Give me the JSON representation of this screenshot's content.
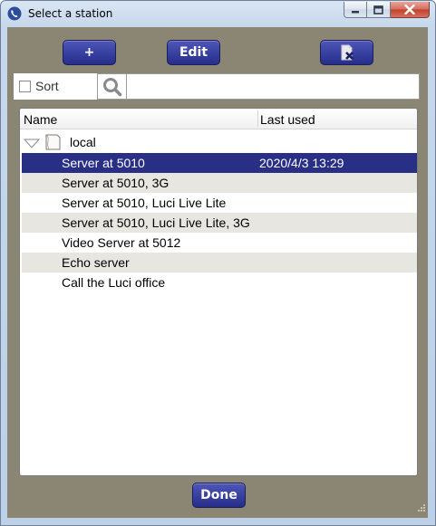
{
  "window": {
    "title": "Select a station",
    "icons": {
      "app": "phone-icon",
      "minimize": "minimize-icon",
      "maximize": "maximize-icon",
      "close": "close-icon"
    }
  },
  "toolbar": {
    "add_label": "+",
    "edit_label": "Edit",
    "delete_icon": "delete-document-icon"
  },
  "filter": {
    "sort_label": "Sort",
    "sort_checked": false,
    "search_value": "",
    "search_icon": "search-icon"
  },
  "list": {
    "columns": [
      "Name",
      "Last used"
    ],
    "group": {
      "label": "local",
      "expanded": true
    },
    "rows": [
      {
        "name": "Server at 5010",
        "last_used": "2020/4/3 13:29",
        "selected": true
      },
      {
        "name": "Server at 5010, 3G",
        "last_used": ""
      },
      {
        "name": "Server at 5010, Luci Live Lite",
        "last_used": ""
      },
      {
        "name": "Server at 5010, Luci Live Lite, 3G",
        "last_used": ""
      },
      {
        "name": "Video Server at 5012",
        "last_used": ""
      },
      {
        "name": "Echo server",
        "last_used": ""
      },
      {
        "name": "Call the Luci office",
        "last_used": ""
      }
    ]
  },
  "footer": {
    "done_label": "Done"
  },
  "colors": {
    "client_bg": "#8b8573",
    "button_bg": "#262d8a",
    "selected_row": "#2a2f86"
  }
}
